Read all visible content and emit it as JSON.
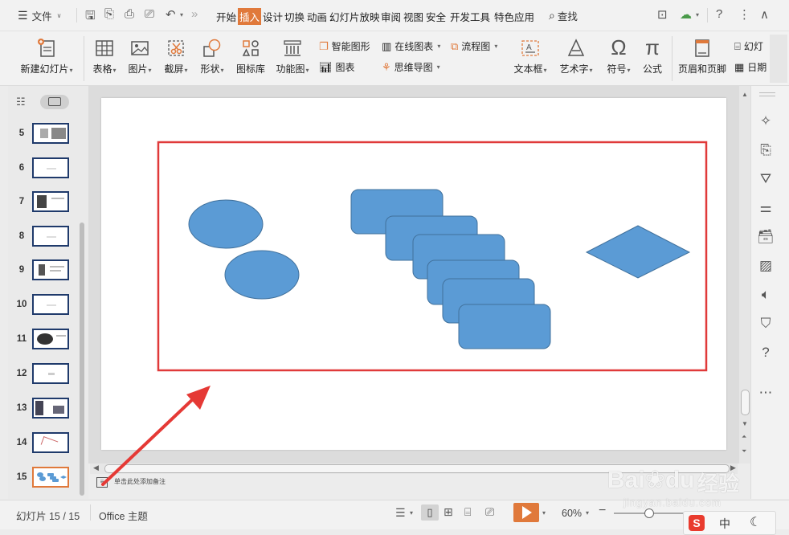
{
  "menu": {
    "file": "文件",
    "tabs": [
      "开始",
      "插入",
      "设计",
      "切换",
      "动画",
      "幻灯片放映",
      "审阅",
      "视图",
      "安全",
      "开发工具",
      "特色应用"
    ],
    "active_tab": "插入",
    "search": "查找"
  },
  "ribbon": {
    "new_slide": "新建幻灯片",
    "table": "表格",
    "picture": "图片",
    "screenshot": "截屏",
    "shape": "形状",
    "icon_lib": "图标库",
    "function_chart": "功能图",
    "smart_graphic": "智能图形",
    "chart": "图表",
    "online_chart": "在线图表",
    "mind_map": "思维导图",
    "flowchart": "流程图",
    "textbox": "文本框",
    "art_text": "艺术字",
    "symbol": "符号",
    "formula": "公式",
    "header_footer": "页眉和页脚",
    "slide_num": "幻灯",
    "date": "日期"
  },
  "thumbnails": [
    "5",
    "6",
    "7",
    "8",
    "9",
    "10",
    "11",
    "12",
    "13",
    "14",
    "15"
  ],
  "active_slide": "15",
  "notes_placeholder": "单击此处添加备注",
  "status": {
    "slide_info": "幻灯片 15 / 15",
    "theme": "Office 主题",
    "zoom": "60%"
  },
  "ime": {
    "lang": "中"
  },
  "watermark": {
    "brand": "Bai",
    "brand2": "du",
    "cn": "经验",
    "url": "jingyan.baidu.com"
  },
  "colors": {
    "accent": "#e0793b",
    "shape_fill": "#5b9bd5",
    "shape_stroke": "#41719c",
    "highlight": "#e03a3a",
    "thumb_border": "#1f3a6b"
  }
}
